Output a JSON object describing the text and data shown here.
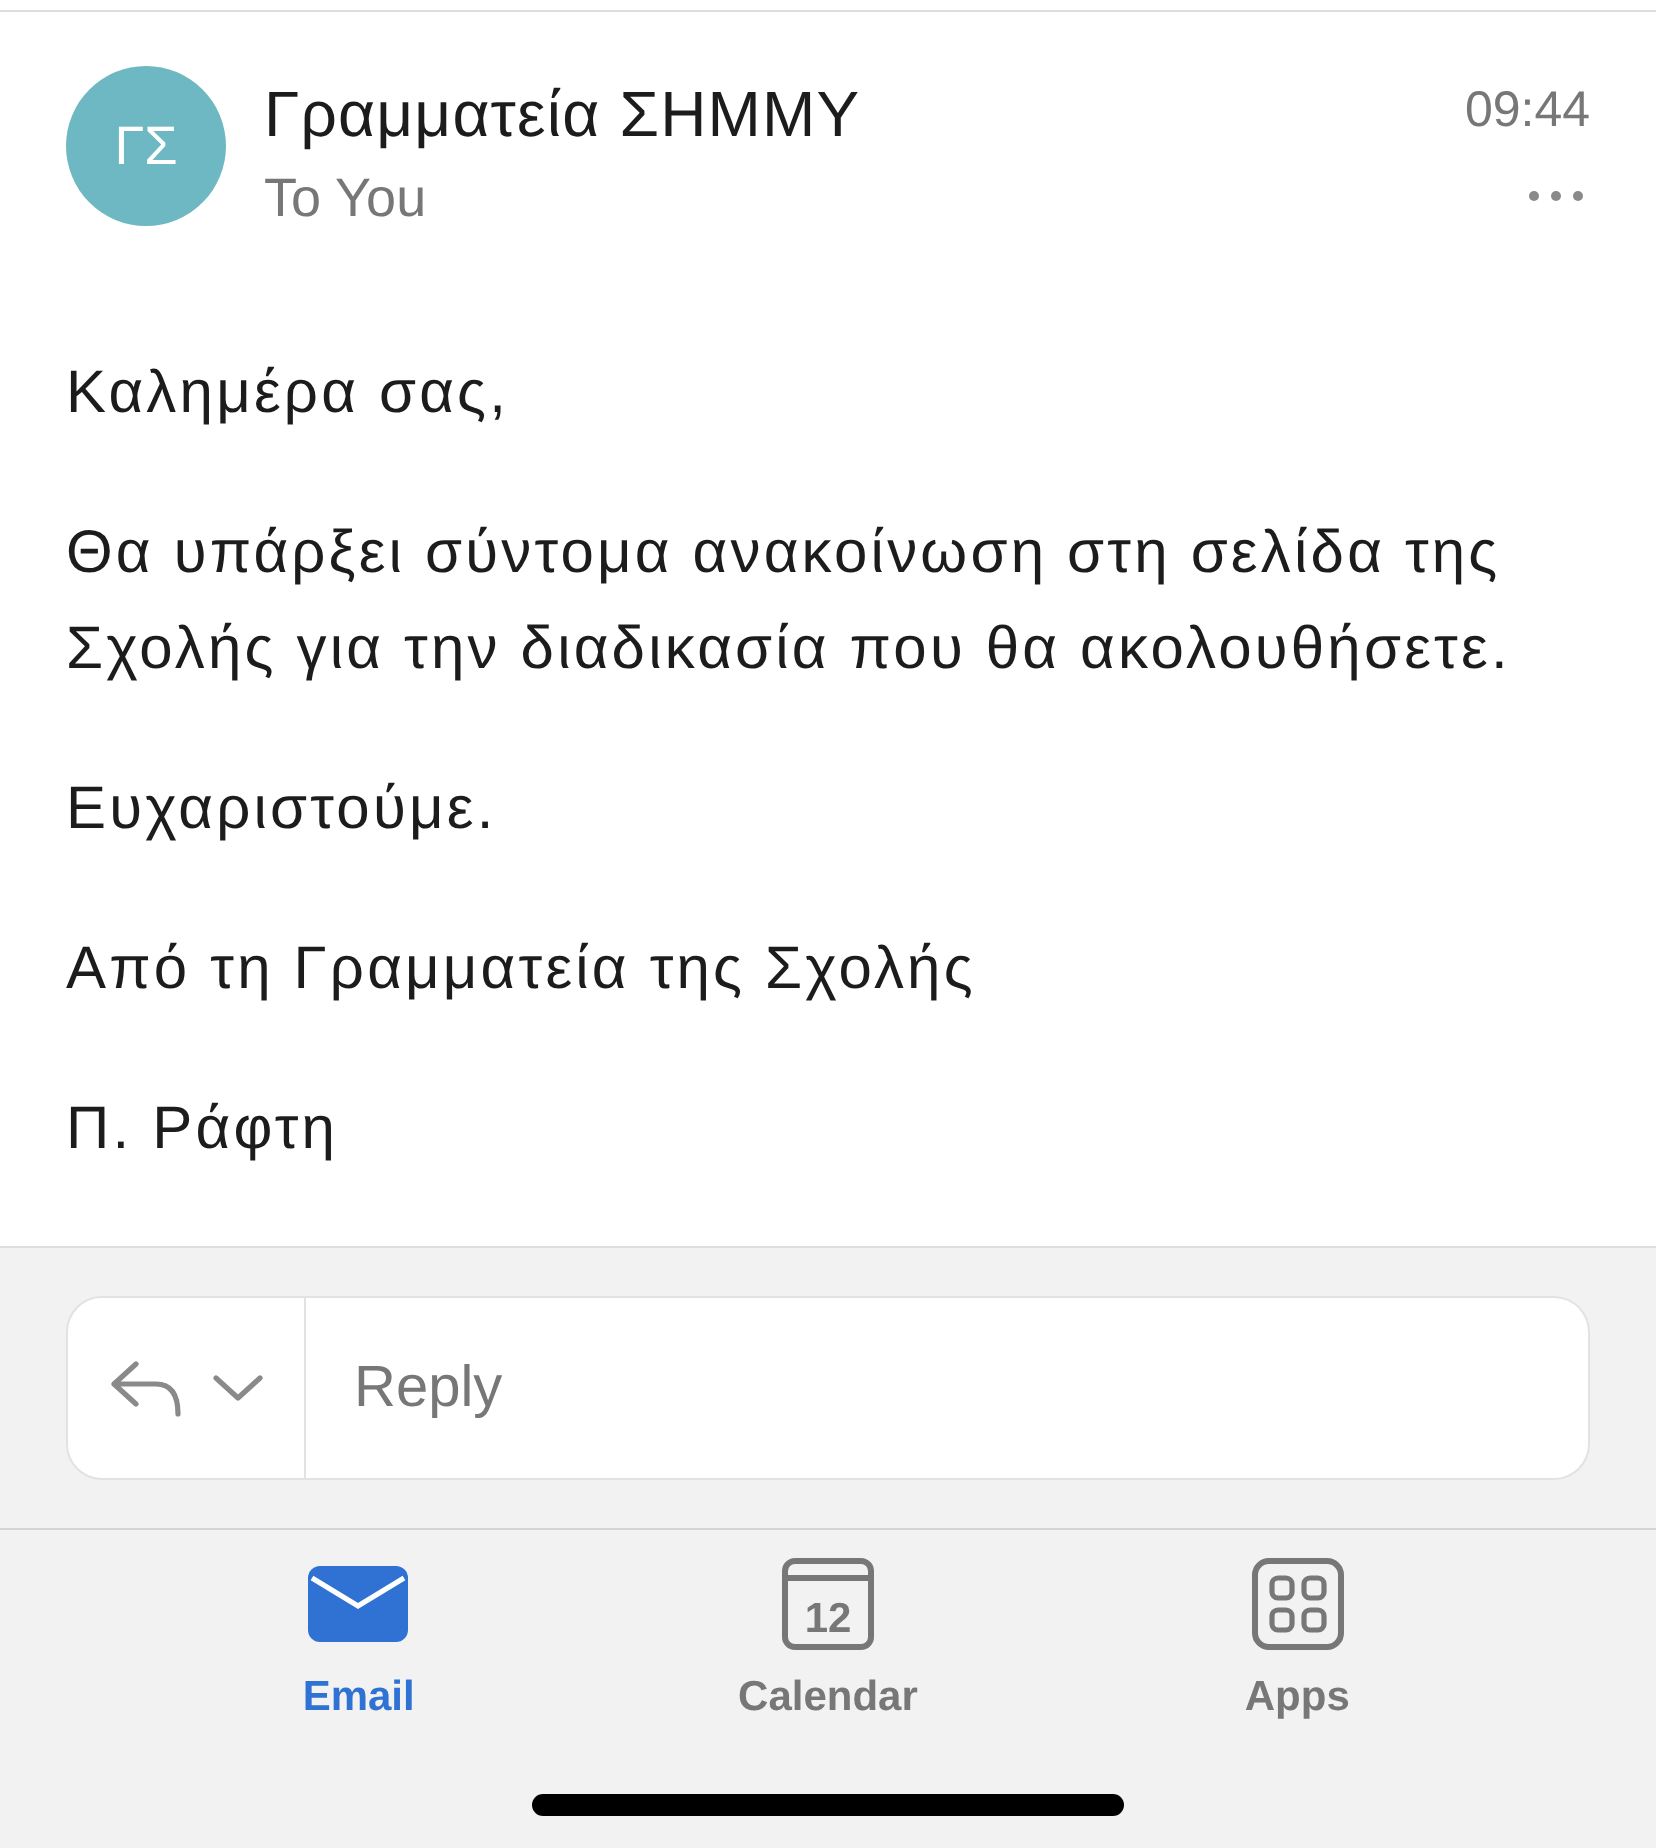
{
  "message": {
    "avatar_initials": "ΓΣ",
    "sender": "Γραμματεία ΣΗΜΜΥ",
    "recipient": "To You",
    "time": "09:44",
    "body": [
      "Καλημέρα σας,",
      "Θα υπάρξει σύντομα ανακοίνωση στη σελίδα της Σχολής για την διαδικασία που θα ακολουθήσετε.",
      "Ευχαριστούμε.",
      "Από τη Γραμματεία της Σχολής",
      "Π. Ράφτη"
    ]
  },
  "reply": {
    "placeholder": "Reply"
  },
  "tabs": [
    {
      "kind": "email",
      "label": "Email",
      "selected": true
    },
    {
      "kind": "calendar",
      "label": "Calendar",
      "icon_text": "12",
      "selected": false
    },
    {
      "kind": "apps",
      "label": "Apps",
      "selected": false
    }
  ]
}
